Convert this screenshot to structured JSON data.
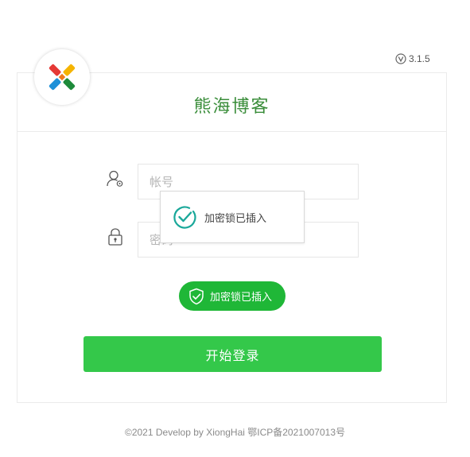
{
  "version": "3.1.5",
  "title": "熊海博客",
  "form": {
    "username_placeholder": "帐号",
    "password_placeholder": "密码"
  },
  "toast": {
    "message": "加密锁已插入",
    "icon": "check-circle-icon"
  },
  "lock_status": {
    "label": "加密锁已插入",
    "icon": "shield-check-icon"
  },
  "login_button": "开始登录",
  "footer": "©2021 Develop by XiongHai 鄂ICP备2021007013号",
  "colors": {
    "accent": "#34c84a",
    "title": "#3a8d3a",
    "pill": "#1fb737",
    "toast_check": "#1aa89a"
  }
}
